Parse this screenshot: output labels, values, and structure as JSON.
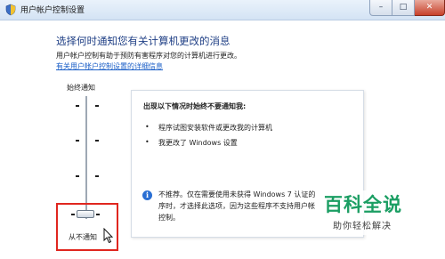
{
  "window": {
    "title": "用户帐户控制设置",
    "controls": {
      "minimize": "–",
      "maximize": "□",
      "close": "✕"
    }
  },
  "header": {
    "title": "选择何时通知您有关计算机更改的消息",
    "description": "用户帐户控制有助于预防有害程序对您的计算机进行更改。",
    "help_link": "有关用户帐户控制设置的详细信息"
  },
  "slider": {
    "top_label": "始终通知",
    "bottom_label": "从不通知",
    "levels": 4,
    "selected_level": 1
  },
  "info_panel": {
    "heading": "出现以下情况时始终不要通知我:",
    "bullets": [
      "程序试图安装软件或更改我的计算机",
      "我更改了 Windows 设置"
    ],
    "note_lines": [
      "不推荐。仅在需要使用未获得 Windows 7 认证的",
      "序时，才选择此选项，因为这些程序不支持用户帐",
      "控制。"
    ]
  },
  "watermark": {
    "title": "百科全说",
    "subtitle": "助你轻松解决"
  },
  "colors": {
    "title_blue": "#1f3f85",
    "link_blue": "#1a5ec7",
    "highlight_red": "#e0261f",
    "watermark_green": "#1b9e63"
  },
  "icons": {
    "app": "shield-icon",
    "info": "info-icon",
    "cursor": "mouse-cursor-icon"
  }
}
